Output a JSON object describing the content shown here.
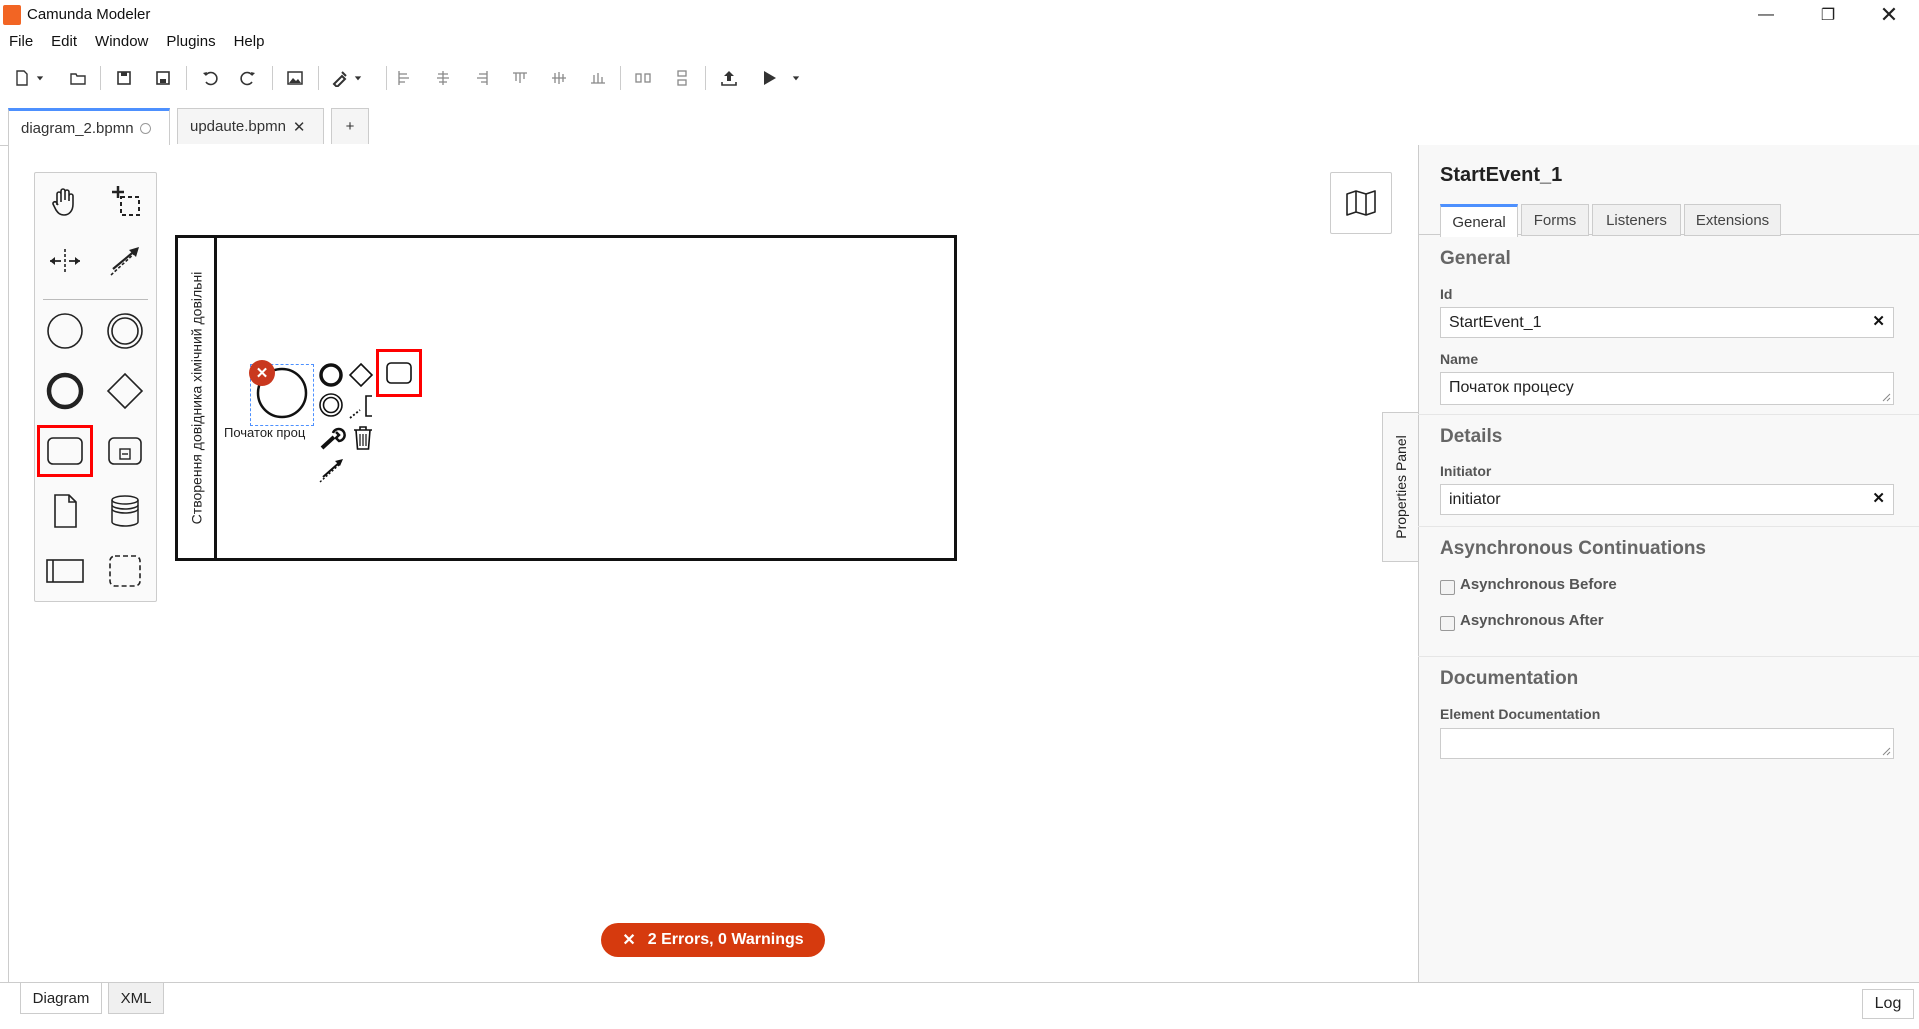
{
  "window": {
    "title": "Camunda Modeler"
  },
  "menu": [
    "File",
    "Edit",
    "Window",
    "Plugins",
    "Help"
  ],
  "tabs": [
    {
      "label": "diagram_2.bpmn"
    },
    {
      "label": "updaute.bpmn"
    },
    {
      "label": "+"
    }
  ],
  "diagram": {
    "lane_label": "Створення довідника хімічний довільні",
    "start_event_label": "Початок проц"
  },
  "status": {
    "errors": "2 Errors, 0 Warnings"
  },
  "bottom_tabs": [
    "Diagram",
    "XML"
  ],
  "log_label": "Log",
  "properties": {
    "toggle_label": "Properties Panel",
    "element_title": "StartEvent_1",
    "tabs": [
      "General",
      "Forms",
      "Listeners",
      "Extensions"
    ],
    "general_title": "General",
    "id_label": "Id",
    "id_value": "StartEvent_1",
    "name_label": "Name",
    "name_value": "Початок процесу",
    "details_title": "Details",
    "initiator_label": "Initiator",
    "initiator_value": "initiator",
    "async_title": "Asynchronous Continuations",
    "async_before": "Asynchronous Before",
    "async_after": "Asynchronous After",
    "documentation_title": "Documentation",
    "element_doc_label": "Element Documentation",
    "element_doc_value": ""
  },
  "colors": {
    "accent": "#4d90fe",
    "error": "#d63a0e",
    "highlight": "#ff0000",
    "logo": "#f26524"
  }
}
